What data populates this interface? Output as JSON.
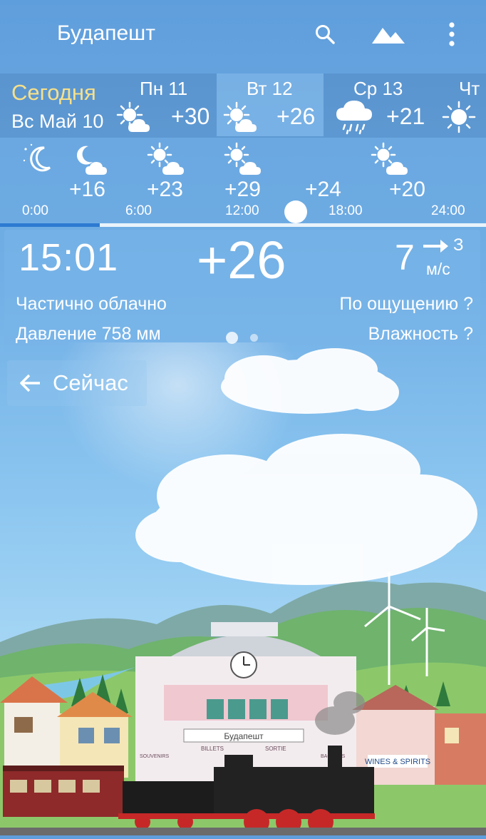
{
  "header": {
    "city": "Будапешт"
  },
  "icons": {
    "search": "search-icon",
    "landscape": "landscape-icon",
    "menu": "more-vert-icon"
  },
  "daily": {
    "today": {
      "label": "Сегодня",
      "date": "Вс Май 10"
    },
    "days": [
      {
        "name": "Пн 11",
        "temp": "+30",
        "icon": "partly-cloudy-icon"
      },
      {
        "name": "Вт 12",
        "temp": "+26",
        "icon": "partly-cloudy-icon",
        "selected": true
      },
      {
        "name": "Ср 13",
        "temp": "+21",
        "icon": "rain-icon"
      },
      {
        "name": "Чт",
        "icon": "sun-icon"
      }
    ]
  },
  "hourly": {
    "entries": [
      {
        "temp": "",
        "icon": "night-clear-icon"
      },
      {
        "temp": "+16",
        "icon": "night-cloudy-icon"
      },
      {
        "temp": "+23",
        "icon": "partly-cloudy-icon"
      },
      {
        "temp": "+29",
        "icon": "partly-cloudy-icon"
      },
      {
        "temp": "+24",
        "icon": ""
      },
      {
        "temp": "+20",
        "icon": "partly-cloudy-icon"
      }
    ],
    "ticks": [
      "0:00",
      "6:00",
      "12:00",
      "18:00",
      "24:00"
    ]
  },
  "current": {
    "time": "15:01",
    "temp": "+26",
    "wind_speed": "7",
    "wind_dir_value": "З",
    "wind_unit": "м/с",
    "condition": "Частично облачно",
    "pressure": "Давление 758 мм",
    "feels_like": "По ощущению ?",
    "humidity": "Влажность ?"
  },
  "now_button": {
    "label": "Сейчас"
  },
  "scene": {
    "station_sign": "Будапешт",
    "sign_billets": "BILLETS",
    "sign_sortie": "SORTIE",
    "sign_souvenirs": "SOUVENIRS",
    "sign_bagages": "BAGAGES",
    "shop_sign": "WINES & SPIRITS"
  },
  "colors": {
    "today_label": "#f6e08a",
    "sky_top": "#5f9edc",
    "timeline_past": "#2d7ad2"
  }
}
